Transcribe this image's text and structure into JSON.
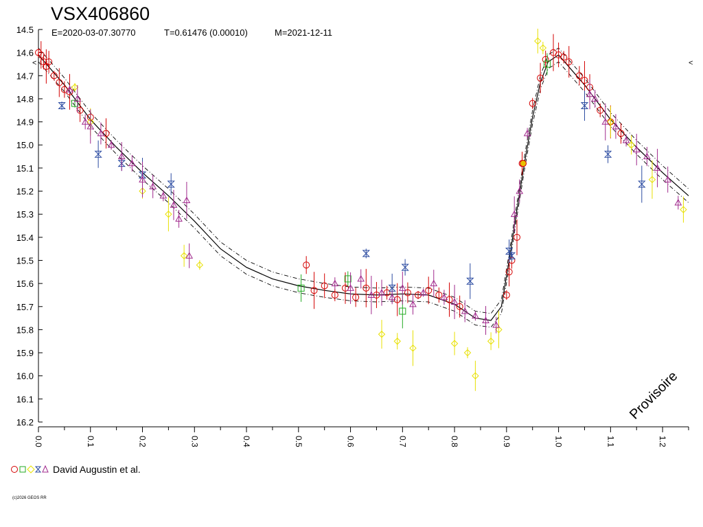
{
  "header": {
    "title": "VSX406860",
    "epoch": "E=2020-03-07.30770",
    "period": "T=0.61476 (0.00010)",
    "mean_date": "M=2021-12-11"
  },
  "watermark": "Provisoire",
  "legend": {
    "markers": [
      "circle",
      "square",
      "diamond",
      "bowtie",
      "triangle"
    ],
    "label": "David Augustin et al."
  },
  "copyright": "(c)2026 GEOS RR",
  "limit_marker": "<",
  "colors": {
    "circle": "#d40000",
    "square": "#22aa22",
    "diamond": "#e8e000",
    "bowtie": "#2a4aa0",
    "triangle": "#a0288c",
    "axis": "#000000",
    "fit": "#000000"
  },
  "chart_data": {
    "type": "scatter",
    "xlabel": "",
    "ylabel": "",
    "xlim": [
      0.0,
      1.25
    ],
    "ylim": [
      16.2,
      14.5
    ],
    "y_inverted": true,
    "x_ticks": [
      "0.0",
      "0.1",
      "0.2",
      "0.3",
      "0.4",
      "0.5",
      "0.6",
      "0.7",
      "0.8",
      "0.9",
      "1.0",
      "1.1",
      "1.2"
    ],
    "y_ticks": [
      "14.5",
      "14.6",
      "14.7",
      "14.8",
      "14.9",
      "15.0",
      "15.1",
      "15.2",
      "15.3",
      "15.4",
      "15.5",
      "15.6",
      "15.7",
      "15.8",
      "15.9",
      "16.0",
      "16.1",
      "16.2"
    ],
    "fit_curve": {
      "x": [
        0.0,
        0.05,
        0.1,
        0.15,
        0.2,
        0.25,
        0.3,
        0.35,
        0.4,
        0.45,
        0.5,
        0.55,
        0.6,
        0.65,
        0.7,
        0.75,
        0.8,
        0.84,
        0.87,
        0.89,
        0.905,
        0.92,
        0.935,
        0.95,
        0.965,
        0.98,
        1.0,
        1.05,
        1.1,
        1.15,
        1.2,
        1.25
      ],
      "y": [
        14.61,
        14.74,
        14.89,
        15.01,
        15.12,
        15.22,
        15.33,
        15.45,
        15.53,
        15.58,
        15.61,
        15.63,
        15.645,
        15.65,
        15.645,
        15.65,
        15.69,
        15.75,
        15.76,
        15.7,
        15.5,
        15.28,
        15.07,
        14.88,
        14.73,
        14.64,
        14.61,
        14.74,
        14.89,
        15.01,
        15.12,
        15.22
      ]
    },
    "fit_band_offset": 0.03,
    "series": [
      {
        "marker": "circle",
        "x": [
          0.0,
          0.005,
          0.01,
          0.015,
          0.02,
          0.03,
          0.04,
          0.05,
          0.06,
          0.08,
          0.1,
          0.13,
          0.515,
          0.53,
          0.55,
          0.57,
          0.59,
          0.61,
          0.63,
          0.65,
          0.67,
          0.69,
          0.71,
          0.73,
          0.75,
          0.77,
          0.79,
          0.81,
          0.9,
          0.905,
          0.91,
          0.92,
          0.93,
          0.95,
          0.965,
          0.975,
          0.99,
          1.0,
          1.01,
          1.02,
          1.04,
          1.05,
          1.06,
          1.08,
          1.1,
          1.12
        ],
        "y": [
          14.6,
          14.61,
          14.64,
          14.66,
          14.64,
          14.7,
          14.73,
          14.76,
          14.77,
          14.85,
          14.88,
          14.95,
          15.52,
          15.63,
          15.61,
          15.65,
          15.62,
          15.66,
          15.62,
          15.65,
          15.64,
          15.67,
          15.64,
          15.65,
          15.63,
          15.65,
          15.67,
          15.7,
          15.65,
          15.55,
          15.5,
          15.4,
          15.08,
          14.82,
          14.71,
          14.63,
          14.6,
          14.61,
          14.62,
          14.64,
          14.7,
          14.72,
          14.75,
          14.85,
          14.9,
          14.95
        ]
      },
      {
        "marker": "square",
        "x": [
          0.07,
          0.505,
          0.595,
          0.7,
          0.978
        ],
        "y": [
          14.82,
          15.62,
          15.58,
          15.72,
          14.65
        ]
      },
      {
        "marker": "diamond",
        "x": [
          0.07,
          0.1,
          0.2,
          0.25,
          0.28,
          0.31,
          0.66,
          0.69,
          0.72,
          0.8,
          0.825,
          0.84,
          0.87,
          0.885,
          0.96,
          0.97,
          1.1,
          1.14,
          1.18,
          1.24
        ],
        "y": [
          14.75,
          14.9,
          15.2,
          15.3,
          15.48,
          15.52,
          15.82,
          15.85,
          15.88,
          15.86,
          15.9,
          16.0,
          15.85,
          15.8,
          14.55,
          14.58,
          14.9,
          15.0,
          15.15,
          15.28
        ]
      },
      {
        "marker": "bowtie",
        "x": [
          0.045,
          0.115,
          0.16,
          0.2,
          0.255,
          0.63,
          0.68,
          0.705,
          0.83,
          0.905,
          0.91,
          1.05,
          1.095,
          1.16
        ],
        "y": [
          14.83,
          15.04,
          15.08,
          15.13,
          15.17,
          15.47,
          15.62,
          15.53,
          15.59,
          15.46,
          15.48,
          14.83,
          15.04,
          15.17
        ]
      },
      {
        "marker": "triangle",
        "x": [
          0.06,
          0.075,
          0.09,
          0.1,
          0.12,
          0.14,
          0.16,
          0.18,
          0.2,
          0.22,
          0.24,
          0.26,
          0.27,
          0.285,
          0.29,
          0.57,
          0.6,
          0.62,
          0.64,
          0.66,
          0.68,
          0.7,
          0.72,
          0.74,
          0.76,
          0.78,
          0.8,
          0.82,
          0.84,
          0.86,
          0.88,
          0.915,
          0.925,
          0.94,
          1.06,
          1.07,
          1.09,
          1.11,
          1.13,
          1.15,
          1.17,
          1.19,
          1.21,
          1.23
        ],
        "y": [
          14.76,
          14.8,
          14.9,
          14.92,
          14.95,
          15.0,
          15.05,
          15.08,
          15.15,
          15.18,
          15.22,
          15.26,
          15.32,
          15.24,
          15.48,
          15.6,
          15.62,
          15.58,
          15.65,
          15.64,
          15.66,
          15.62,
          15.69,
          15.64,
          15.6,
          15.66,
          15.68,
          15.72,
          15.74,
          15.76,
          15.78,
          15.3,
          15.2,
          14.95,
          14.78,
          14.8,
          14.9,
          14.92,
          14.98,
          15.02,
          15.05,
          15.1,
          15.15,
          15.25
        ]
      }
    ]
  }
}
